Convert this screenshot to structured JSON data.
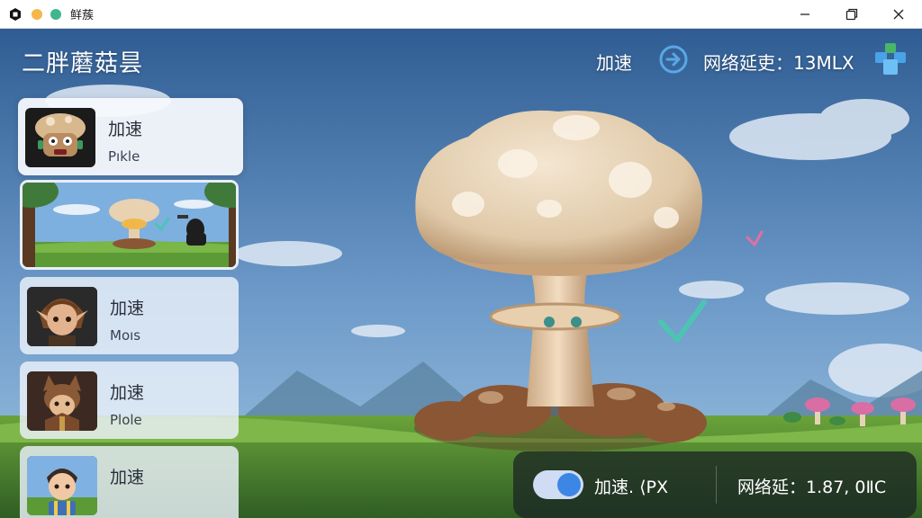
{
  "window": {
    "title": "鲜蔟",
    "controls": {
      "minimize": "minimize-icon",
      "maximize": "maximize-icon",
      "close": "close-icon"
    }
  },
  "header": {
    "app_title": "二胖蘑菇昙",
    "boost_label": "加速",
    "latency_label": "网络延吏：13MLX"
  },
  "game_list": [
    {
      "title": "加速",
      "subtitle": "Pıkle",
      "selected": true,
      "icon": "mushroom-creature-icon"
    },
    {
      "title": "",
      "subtitle": "",
      "banner": true,
      "icon": "mushroom-scene-thumbnail"
    },
    {
      "title": "加速",
      "subtitle": "Moıs",
      "icon": "elf-character-icon"
    },
    {
      "title": "加速",
      "subtitle": "Plole",
      "icon": "fox-warrior-icon"
    },
    {
      "title": "加速",
      "subtitle": "",
      "icon": "boy-character-icon"
    }
  ],
  "bottom_bar": {
    "toggle_on": true,
    "boost_text": "加速. ⟨PX",
    "latency_text": "网络延：1.87, 0ⅡC"
  },
  "colors": {
    "accent": "#3c86e6",
    "sky": "#5f8fc2",
    "grass": "#4d8a2f"
  }
}
